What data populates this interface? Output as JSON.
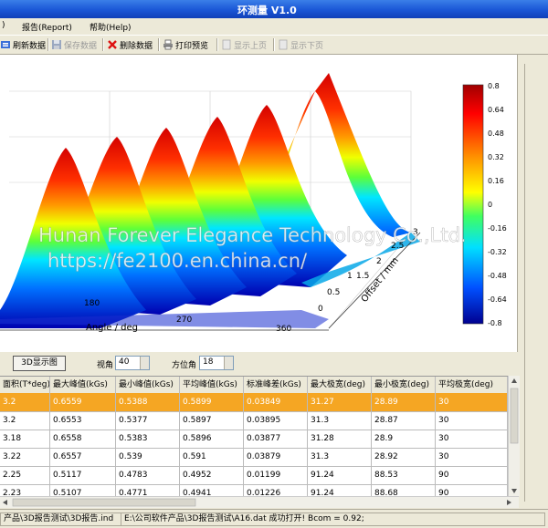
{
  "window": {
    "title": "环测量 V1.0"
  },
  "menu": {
    "partial_first": ")",
    "report": "报告(Report)",
    "help": "帮助(Help)"
  },
  "toolbar": {
    "refresh": "刷新数据",
    "save": "保存数据",
    "delete": "删除数据",
    "print": "打印预览",
    "show_prev": "显示上页",
    "show_next": "显示下页"
  },
  "plot": {
    "watermark_1": "Hunan Forever Elegance Technology Co.,Ltd.",
    "watermark_2": "https://fe2100.en.china.cn/",
    "angle_axis_label": "Angle / deg",
    "angle_ticks": [
      "180",
      "270",
      "360"
    ],
    "offset_axis_label": "Offset / mm",
    "offset_ticks": [
      "0",
      "0.5",
      "1",
      "1.5",
      "2",
      "2.5",
      "3"
    ],
    "colorbar_ticks": [
      "0.8",
      "0.64",
      "0.48",
      "0.32",
      "0.16",
      "0",
      "-0.16",
      "-0.32",
      "-0.48",
      "-0.64",
      "-0.8"
    ]
  },
  "controls": {
    "view3d_button": "3D显示图",
    "view_angle_label": "视角",
    "view_angle_value": "40",
    "azimuth_label": "方位角",
    "azimuth_value": "18"
  },
  "table": {
    "columns": [
      "面积(T*deg)",
      "最大峰值(kGs)",
      "最小峰值(kGs)",
      "平均峰值(kGs)",
      "标准峰差(kGs)",
      "最大极宽(deg)",
      "最小极宽(deg)",
      "平均极宽(deg)"
    ],
    "rows": [
      [
        "3.2",
        "0.6559",
        "0.5388",
        "0.5899",
        "0.03849",
        "31.27",
        "28.89",
        "30"
      ],
      [
        "3.2",
        "0.6553",
        "0.5377",
        "0.5897",
        "0.03895",
        "31.3",
        "28.87",
        "30"
      ],
      [
        "3.18",
        "0.6558",
        "0.5383",
        "0.5896",
        "0.03877",
        "31.28",
        "28.9",
        "30"
      ],
      [
        "3.22",
        "0.6557",
        "0.539",
        "0.591",
        "0.03879",
        "31.3",
        "28.92",
        "30"
      ],
      [
        "2.25",
        "0.5117",
        "0.4783",
        "0.4952",
        "0.01199",
        "91.24",
        "88.53",
        "90"
      ],
      [
        "2.23",
        "0.5107",
        "0.4771",
        "0.4941",
        "0.01226",
        "91.24",
        "88.68",
        "90"
      ]
    ]
  },
  "status": {
    "path1": "产品\\3D报告测试\\3D报告.ind",
    "path2": "E:\\公司软件产品\\3D报告测试\\A16.dat 成功打开! Bcom = 0.92;"
  }
}
